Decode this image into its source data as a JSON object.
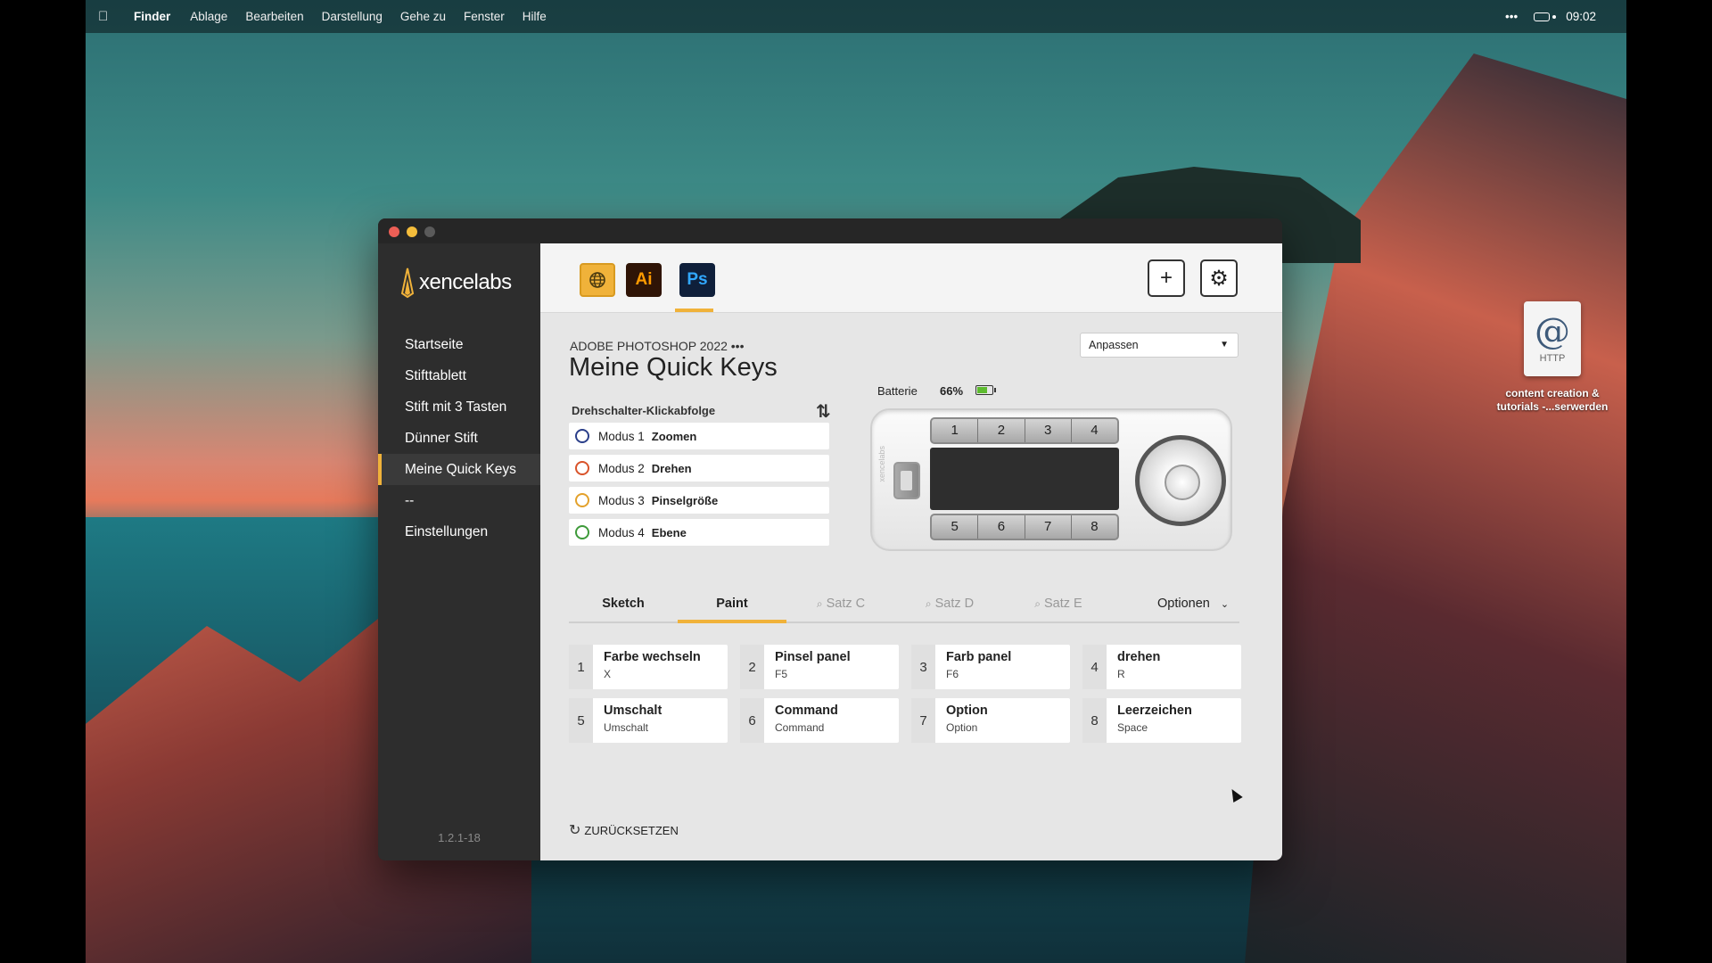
{
  "menubar": {
    "app_name": "Finder",
    "items": [
      "Ablage",
      "Bearbeiten",
      "Darstellung",
      "Gehe zu",
      "Fenster",
      "Hilfe"
    ],
    "more": "•••",
    "time": "09:02"
  },
  "desktop_icon": {
    "glyph": "@",
    "type": "HTTP",
    "label_line1": "content creation &",
    "label_line2": "tutorials -...serwerden"
  },
  "sidebar": {
    "logo": "xencelabs",
    "items": [
      {
        "label": "Startseite"
      },
      {
        "label": "Stifttablett"
      },
      {
        "label": "Stift mit 3 Tasten"
      },
      {
        "label": "Dünner Stift"
      },
      {
        "label": "Meine Quick Keys"
      },
      {
        "label": "--"
      },
      {
        "label": "Einstellungen"
      }
    ],
    "version": "1.2.1-18"
  },
  "topbar": {
    "ai_label": "Ai",
    "ps_label": "Ps",
    "add_symbol": "+",
    "gear_symbol": "⚙"
  },
  "header": {
    "app_name": "ADOBE PHOTOSHOP 2022 •••",
    "title": "Meine Quick Keys",
    "select_value": "Anpassen"
  },
  "dial": {
    "label": "Drehschalter-Klickabfolge",
    "sort_symbol": "⇅",
    "modes": [
      {
        "label": "Modus 1",
        "name": "Zoomen",
        "color": "#2b3f8a"
      },
      {
        "label": "Modus 2",
        "name": "Drehen",
        "color": "#d9532a"
      },
      {
        "label": "Modus 3",
        "name": "Pinselgröße",
        "color": "#e3a12b"
      },
      {
        "label": "Modus 4",
        "name": "Ebene",
        "color": "#3e9a3a"
      }
    ]
  },
  "battery": {
    "label": "Batterie",
    "percent": "66%",
    "level": 0.66
  },
  "remote": {
    "brand": "xencelabs",
    "top_keys": [
      "1",
      "2",
      "3",
      "4"
    ],
    "bottom_keys": [
      "5",
      "6",
      "7",
      "8"
    ]
  },
  "sets": {
    "tabs": [
      {
        "label": "Sketch",
        "active": true,
        "linked": false
      },
      {
        "label": "Paint",
        "active": true,
        "linked": false
      },
      {
        "label": "Satz C",
        "active": false,
        "linked": true
      },
      {
        "label": "Satz D",
        "active": false,
        "linked": true
      },
      {
        "label": "Satz E",
        "active": false,
        "linked": true
      }
    ],
    "selected": "Paint",
    "options_label": "Optionen"
  },
  "keys": [
    {
      "num": "1",
      "name": "Farbe wechseln",
      "value": "X"
    },
    {
      "num": "2",
      "name": "Pinsel panel",
      "value": "F5"
    },
    {
      "num": "3",
      "name": "Farb panel",
      "value": "F6"
    },
    {
      "num": "4",
      "name": "drehen",
      "value": "R"
    },
    {
      "num": "5",
      "name": "Umschalt",
      "value": "Umschalt"
    },
    {
      "num": "6",
      "name": "Command",
      "value": "Command"
    },
    {
      "num": "7",
      "name": "Option",
      "value": "Option"
    },
    {
      "num": "8",
      "name": "Leerzeichen",
      "value": "Space"
    }
  ],
  "reset_label": "ZURÜCKSETZEN",
  "colors": {
    "accent": "#f0b23a",
    "sidebar_bg": "#2d2d2d",
    "battery_green": "#5dbb2f"
  }
}
